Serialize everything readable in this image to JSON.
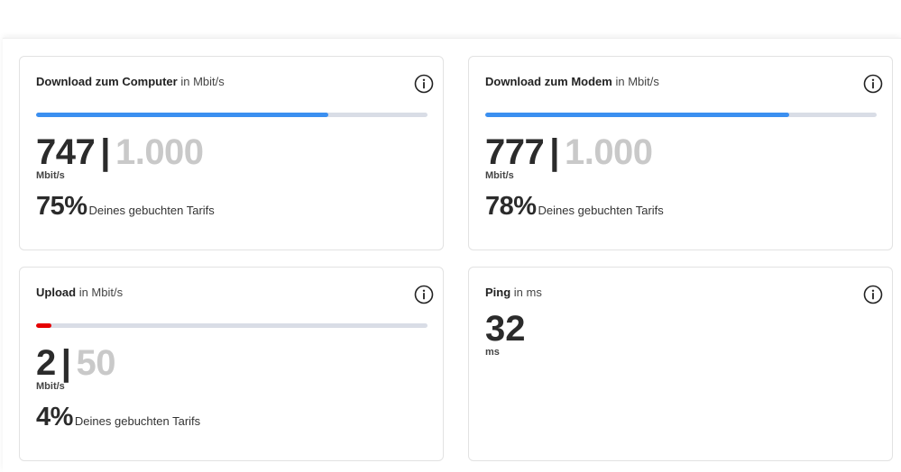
{
  "colors": {
    "download_bar": "#3b8ff0",
    "upload_bar": "#e60000",
    "track": "#d9dde6"
  },
  "cards": {
    "download_computer": {
      "title": "Download zum Computer",
      "unit_label": "in Mbit/s",
      "value": "747",
      "separator": "|",
      "max": "1.000",
      "unit": "Mbit/s",
      "percent": "75%",
      "percent_label": "Deines gebuchten Tarifs",
      "progress": 0.747,
      "icon": "info-icon"
    },
    "download_modem": {
      "title": "Download zum Modem",
      "unit_label": "in Mbit/s",
      "value": "777",
      "separator": "|",
      "max": "1.000",
      "unit": "Mbit/s",
      "percent": "78%",
      "percent_label": "Deines gebuchten Tarifs",
      "progress": 0.777,
      "icon": "info-icon"
    },
    "upload": {
      "title": "Upload",
      "unit_label": "in Mbit/s",
      "value": "2",
      "separator": "|",
      "max": "50",
      "unit": "Mbit/s",
      "percent": "4%",
      "percent_label": "Deines gebuchten Tarifs",
      "progress": 0.04,
      "icon": "info-icon"
    },
    "ping": {
      "title": "Ping",
      "unit_label": "in ms",
      "value": "32",
      "unit": "ms",
      "icon": "info-icon"
    }
  }
}
